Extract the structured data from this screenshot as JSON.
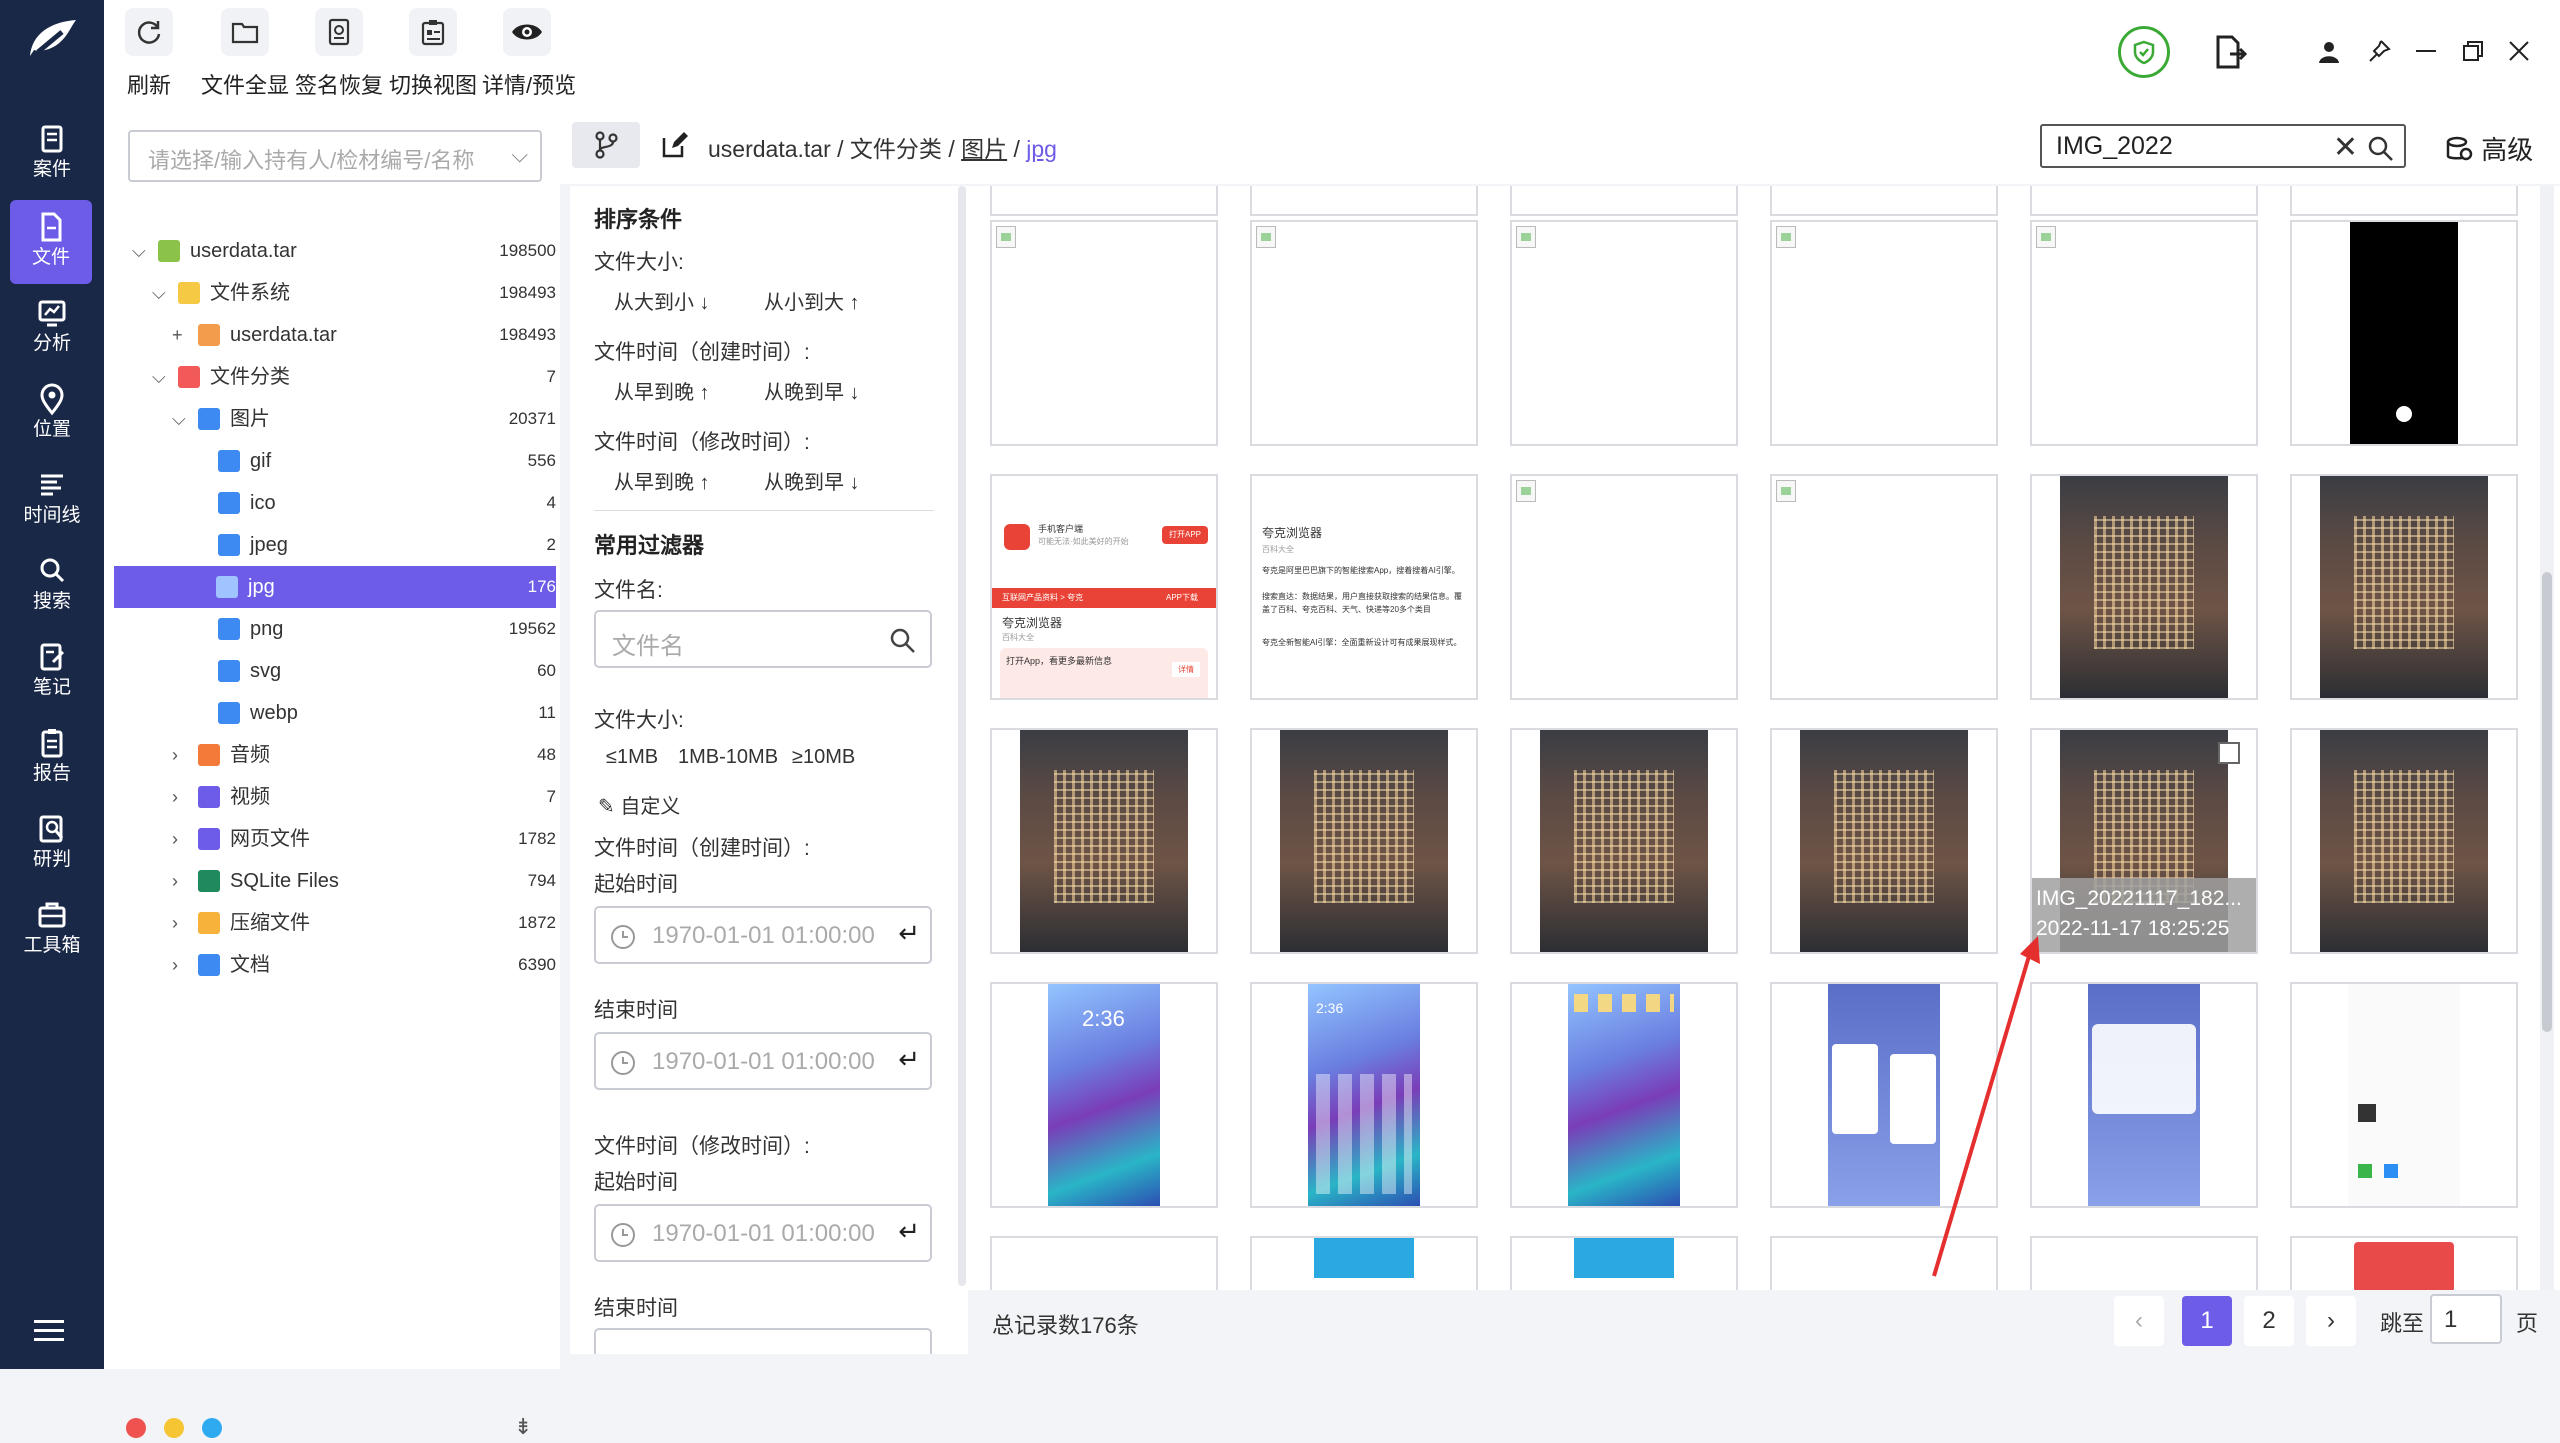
{
  "rail": {
    "items": [
      {
        "label": "案件",
        "icon": "case-icon"
      },
      {
        "label": "文件",
        "icon": "file-icon"
      },
      {
        "label": "分析",
        "icon": "analysis-icon"
      },
      {
        "label": "位置",
        "icon": "location-icon"
      },
      {
        "label": "时间线",
        "icon": "timeline-icon"
      },
      {
        "label": "搜索",
        "icon": "search-icon"
      },
      {
        "label": "笔记",
        "icon": "note-icon"
      },
      {
        "label": "报告",
        "icon": "report-icon"
      },
      {
        "label": "研判",
        "icon": "judge-icon"
      },
      {
        "label": "工具箱",
        "icon": "toolbox-icon"
      }
    ],
    "active": "文件"
  },
  "toolbar": {
    "buttons": [
      {
        "label": "刷新",
        "icon": "refresh-icon"
      },
      {
        "label": "文件全显",
        "icon": "folder-icon"
      },
      {
        "label": "签名恢复",
        "icon": "signature-icon"
      },
      {
        "label": "切换视图",
        "icon": "view-switch-icon"
      },
      {
        "label": "详情/预览",
        "icon": "eye-icon"
      }
    ]
  },
  "tree": {
    "placeholder": "请选择/输入持有人/检材编号/名称",
    "rows": [
      {
        "label": "userdata.tar",
        "count": "198500",
        "icon": "android-icon"
      },
      {
        "label": "文件系统",
        "count": "198493",
        "icon": "folder-icon"
      },
      {
        "label": "userdata.tar",
        "count": "198493",
        "icon": "archive-icon"
      },
      {
        "label": "文件分类",
        "count": "7",
        "icon": "category-icon"
      },
      {
        "label": "图片",
        "count": "20371",
        "icon": "image-icon"
      },
      {
        "label": "gif",
        "count": "556",
        "icon": "image-icon"
      },
      {
        "label": "ico",
        "count": "4",
        "icon": "image-icon"
      },
      {
        "label": "jpeg",
        "count": "2",
        "icon": "image-icon"
      },
      {
        "label": "jpg",
        "count": "176",
        "icon": "image-icon"
      },
      {
        "label": "png",
        "count": "19562",
        "icon": "image-icon"
      },
      {
        "label": "svg",
        "count": "60",
        "icon": "image-icon"
      },
      {
        "label": "webp",
        "count": "11",
        "icon": "image-icon"
      },
      {
        "label": "音频",
        "count": "48",
        "icon": "audio-icon"
      },
      {
        "label": "视频",
        "count": "7",
        "icon": "video-icon"
      },
      {
        "label": "网页文件",
        "count": "1782",
        "icon": "web-icon"
      },
      {
        "label": "SQLite Files",
        "count": "794",
        "icon": "database-icon"
      },
      {
        "label": "压缩文件",
        "count": "1872",
        "icon": "zip-icon"
      },
      {
        "label": "文档",
        "count": "6390",
        "icon": "doc-icon"
      }
    ]
  },
  "breadcrumb": {
    "root": "userdata.tar",
    "sep": "/",
    "level1": "文件分类",
    "level2": "图片",
    "current": "jpg"
  },
  "search": {
    "value": "IMG_2022",
    "advanced_label": "高级"
  },
  "filters": {
    "sort_title": "排序条件",
    "size_label": "文件大小:",
    "size_desc": "从大到小",
    "size_asc": "从小到大",
    "ctime_label": "文件时间（创建时间）:",
    "ctime_asc": "从早到晚",
    "ctime_desc": "从晚到早",
    "mtime_label": "文件时间（修改时间）:",
    "mtime_asc": "从早到晚",
    "mtime_desc": "从晚到早",
    "common_title": "常用过滤器",
    "name_label": "文件名:",
    "name_placeholder": "文件名",
    "size2_label": "文件大小:",
    "size_opt1": "≤1MB",
    "size_opt2": "1MB-10MB",
    "size_opt3": "≥10MB",
    "custom": "自定义",
    "ctime2_label": "文件时间（创建时间）:",
    "start_label": "起始时间",
    "start_value": "1970-01-01 01:00:00",
    "end_label": "结束时间",
    "end_value": "1970-01-01 01:00:00",
    "mtime2_label": "文件时间（修改时间）:",
    "start2_label": "起始时间",
    "start2_value": "1970-01-01 01:00:00",
    "end2_label": "结束时间"
  },
  "hover_caption": {
    "name": "IMG_20221117_182...",
    "time": "2022-11-17 18:25:25"
  },
  "mini": {
    "app_title": "手机客户端",
    "app_sub": "可能无法·如此美好的开始",
    "app_btn": "打开APP",
    "crumb_app": "互联网产品资料 > 夸克",
    "app_store": "APP下载",
    "browser": "夸克浏览器",
    "baike": "百科大全",
    "open_app": "打开App，看更多最新信息",
    "detail_btn": "详情",
    "quark_intro": "夸克是阿里巴巴旗下的智能搜索App，搜着搜着AI引擎。",
    "quark_l2": "搜索直达：数据结果，用户直接获取搜索的结果信息。覆盖了百科、夸克百科、天气、快递等20多个类目",
    "quark_l3": "夸克全新智能AI引擎：全面重新设计可有成果展现样式。",
    "time1": "2:36"
  },
  "status": {
    "total": "总记录数176条",
    "page1": "1",
    "page2": "2",
    "jump_label": "跳至",
    "jump_value": "1",
    "page_unit": "页"
  },
  "colors": {
    "accent": "#6c5ce7",
    "rail": "#1a2847",
    "shield": "#3aaa35"
  }
}
